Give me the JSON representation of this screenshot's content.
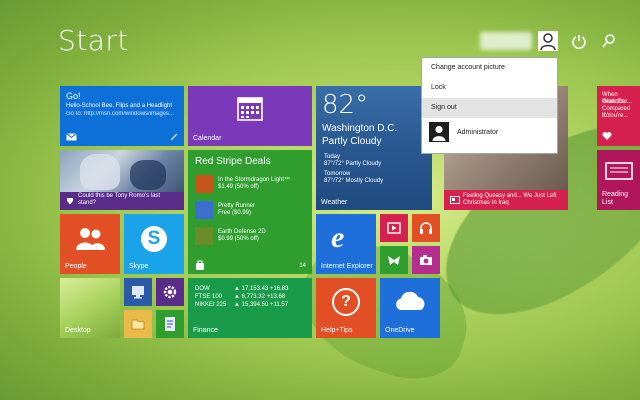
{
  "start_title": "Start",
  "header": {
    "power_icon": "power-icon",
    "search_icon": "search-icon"
  },
  "account_menu": {
    "items": [
      "Change account picture",
      "Lock",
      "Sign out"
    ],
    "user_name": "Administrator"
  },
  "tiles": {
    "mail": {
      "line1": "Go!",
      "line2": "Hello-School Bee, Flips and a Headlight",
      "line3": "Go to: http://msn.com/windows/images..."
    },
    "calendar": {
      "label": "Calendar"
    },
    "weather": {
      "temp": "82°",
      "city": "Washington D.C.",
      "condition": "Partly Cloudy",
      "today_label": "Today",
      "today_detail": "87°/72° Partly Cloudy",
      "tomorrow_label": "Tomorrow",
      "tomorrow_detail": "87°/72° Mostly Cloudy",
      "label": "Weather"
    },
    "sports": {
      "caption": "Could this be Tony Romo's last stand?"
    },
    "store": {
      "title": "Red Stripe Deals",
      "items": [
        {
          "name": "In the Stormdragon Light™",
          "price": "$1.49 (50% off)"
        },
        {
          "name": "Pretty Runner",
          "price": "Free ($0.99)"
        },
        {
          "name": "Earth Defense 2D",
          "price": "$0.99 (50% off)"
        }
      ],
      "count": "14"
    },
    "people": {
      "label": "People"
    },
    "skype": {
      "label": "Skype"
    },
    "ie": {
      "label": "Internet Explorer"
    },
    "finance": {
      "rows": [
        {
          "name": "DOW",
          "value": "▲ 17,153.43 +16.83"
        },
        {
          "name": "FTSE 100",
          "value": "▲ 6,773.32 +13.68"
        },
        {
          "name": "NIKKEI 225",
          "value": "▲ 15,394.50 +11.57"
        }
      ],
      "label": "Finance"
    },
    "desktop": {
      "label": "Desktop"
    },
    "help": {
      "label": "Help+Tips"
    },
    "onedrive": {
      "label": "OneDrive"
    },
    "news": {
      "caption": "Feeling Queasy and... We Just Left Christmas In Iraq"
    },
    "right_red": {
      "lines": [
        "When Grandm...",
        "Work Car...",
        "Compared to...",
        "If You're..."
      ]
    },
    "reading_list": {
      "label": "Reading List"
    }
  },
  "colors": {
    "mail_blue": "#0d6fd8",
    "purple": "#7b39b9",
    "weather_blue": "#1d5fa6",
    "store_green": "#2f9e2f",
    "orange_red": "#e24f24",
    "skype_blue": "#1aa3e8",
    "crimson": "#d6204e"
  }
}
